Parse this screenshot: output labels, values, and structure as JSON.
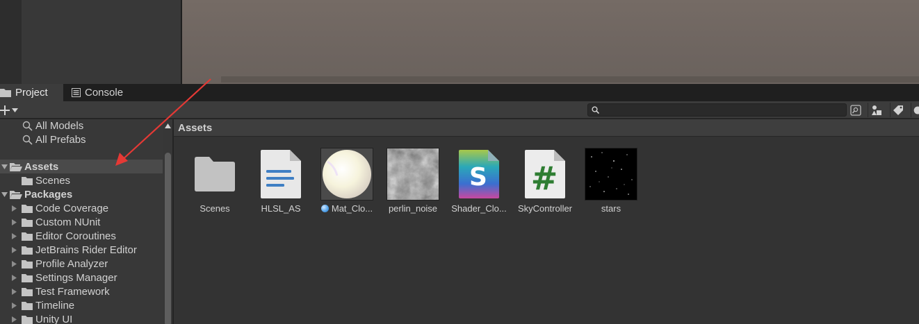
{
  "tabs": {
    "project": "Project",
    "console": "Console"
  },
  "toolbar": {
    "create_label": "+",
    "search_value": "",
    "search_placeholder": ""
  },
  "tree": {
    "favorites": [
      {
        "label": "All Models",
        "icon": "search-icon"
      },
      {
        "label": "All Prefabs",
        "icon": "search-icon"
      }
    ],
    "assets": {
      "label": "Assets",
      "children": [
        {
          "label": "Scenes"
        }
      ]
    },
    "packages": {
      "label": "Packages",
      "children": [
        {
          "label": "Code Coverage"
        },
        {
          "label": "Custom NUnit"
        },
        {
          "label": "Editor Coroutines"
        },
        {
          "label": "JetBrains Rider Editor"
        },
        {
          "label": "Profile Analyzer"
        },
        {
          "label": "Settings Manager"
        },
        {
          "label": "Test Framework"
        },
        {
          "label": "Timeline"
        },
        {
          "label": "Unity UI"
        }
      ]
    }
  },
  "breadcrumb": "Assets",
  "assets": [
    {
      "label": "Scenes",
      "icon": "folder-icon"
    },
    {
      "label": "HLSL_AS",
      "icon": "text-file-icon"
    },
    {
      "label": "Mat_Clo...",
      "icon": "material-icon"
    },
    {
      "label": "perlin_noise",
      "icon": "texture-icon"
    },
    {
      "label": "Shader_Clo...",
      "icon": "shader-icon"
    },
    {
      "label": "SkyController",
      "icon": "csharp-script-icon"
    },
    {
      "label": "stars",
      "icon": "texture-icon"
    }
  ],
  "colors": {
    "annotation_arrow": "#e53935",
    "csharp_green": "#2e7d32",
    "text_file_blue": "#3f7fc4"
  }
}
